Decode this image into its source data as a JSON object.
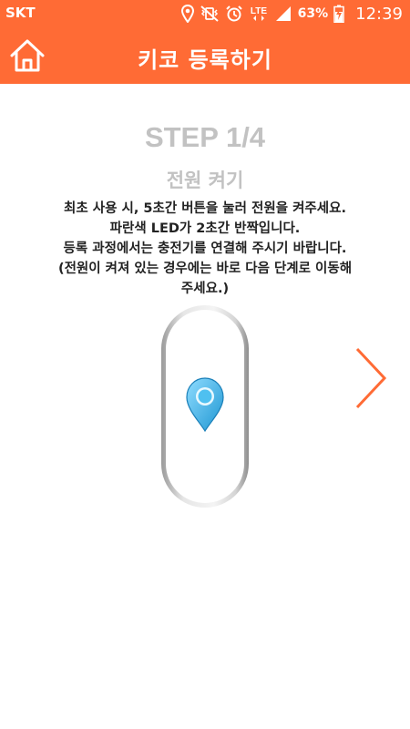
{
  "status_bar": {
    "carrier": "SKT",
    "network": "LTE",
    "battery_percent": "63%",
    "time": "12:39",
    "icons": [
      "location-icon",
      "mute-vibrate-icon",
      "alarm-icon",
      "lte-icon",
      "signal-icon",
      "battery-charging-icon"
    ]
  },
  "header": {
    "title": "키코 등록하기",
    "home_icon": "home-icon",
    "background_color": "#FF6B35"
  },
  "step": {
    "title": "STEP 1/4",
    "subtitle": "전원 켜기",
    "instructions": [
      "최초 사용 시, 5초간 버튼을 눌러 전원을 켜주세요.",
      "파란색 LED가 2초간 반짝입니다.",
      "등록 과정에서는 충전기를 연결해 주시기 바랍니다.",
      "(전원이 켜져 있는 경우에는 바로 다음 단계로 이동해",
      "주세요.)"
    ]
  },
  "device": {
    "icon": "location-pin-icon",
    "pin_color": "#3BB3E8"
  },
  "navigation": {
    "next_icon": "chevron-right-icon",
    "accent_color": "#FF6B35"
  }
}
